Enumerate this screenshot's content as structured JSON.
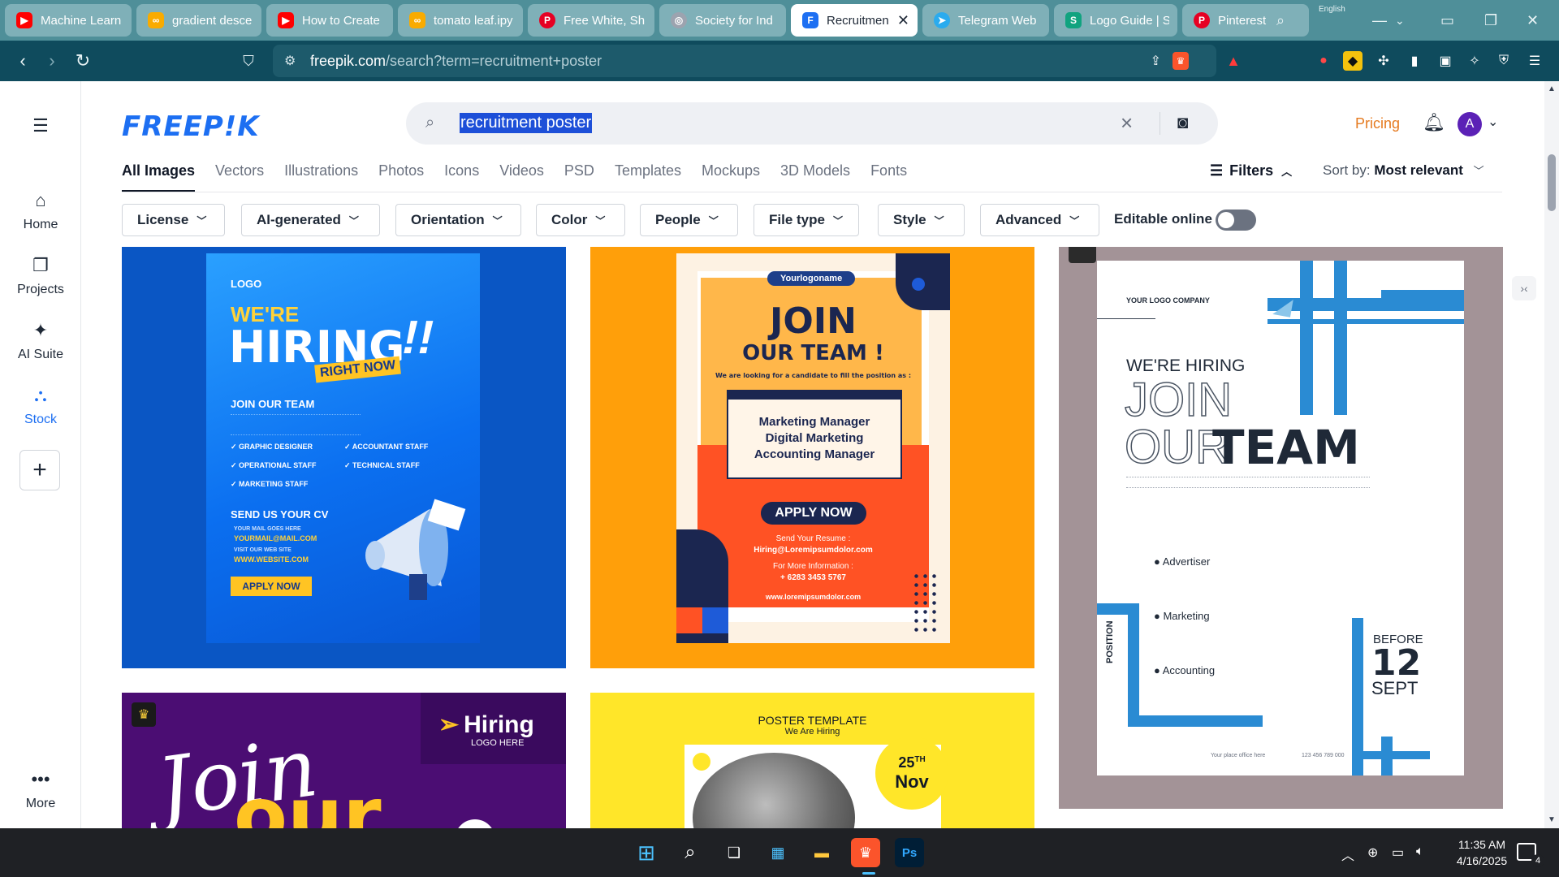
{
  "browser": {
    "tabs": [
      {
        "label": "Machine Learn",
        "icon": "youtube-icon",
        "color": "#ff0000"
      },
      {
        "label": "gradient desce",
        "icon": "colab-icon",
        "color": "#f9ab00"
      },
      {
        "label": "How to Create",
        "icon": "youtube-icon",
        "color": "#ff0000"
      },
      {
        "label": "tomato leaf.ipy",
        "icon": "colab-icon",
        "color": "#f9ab00"
      },
      {
        "label": "Free White, Sh",
        "icon": "pinterest-icon",
        "color": "#e60023"
      },
      {
        "label": "Society for Ind",
        "icon": "globe-icon",
        "color": "#9ca3af"
      },
      {
        "label": "Recruitmen",
        "icon": "freepik-icon",
        "color": "#1d6ff2"
      },
      {
        "label": "Telegram Web",
        "icon": "telegram-icon",
        "color": "#2aabee"
      },
      {
        "label": "Logo Guide | S",
        "icon": "s-icon",
        "color": "#10a37f"
      },
      {
        "label": "Pinterest",
        "icon": "pinterest-icon",
        "color": "#e60023"
      }
    ],
    "url_host": "freepik.com",
    "url_path": "/search?term=recruitment+poster",
    "lang_hint": "English"
  },
  "rail": {
    "items": [
      {
        "label": "Home",
        "icon": "home-icon"
      },
      {
        "label": "Projects",
        "icon": "projects-icon"
      },
      {
        "label": "AI Suite",
        "icon": "sparkle-icon"
      },
      {
        "label": "Stock",
        "icon": "stock-icon"
      }
    ],
    "more_label": "More"
  },
  "header": {
    "logo": "FREEP!K",
    "search_query": "recruitment poster",
    "pricing": "Pricing",
    "avatar_initial": "A"
  },
  "categories": [
    "All Images",
    "Vectors",
    "Illustrations",
    "Photos",
    "Icons",
    "Videos",
    "PSD",
    "Templates",
    "Mockups",
    "3D Models",
    "Fonts"
  ],
  "filters_label": "Filters",
  "sort": {
    "label": "Sort by:",
    "value": "Most relevant"
  },
  "chips": [
    "License",
    "AI-generated",
    "Orientation",
    "Color",
    "People",
    "File type",
    "Style",
    "Advanced"
  ],
  "editable_online": "Editable online",
  "card1": {
    "logo": "LOGO",
    "were": "WE'RE",
    "hiring": "HIRING",
    "right_now": "RIGHT NOW",
    "join": "JOIN OUR TEAM",
    "roles": [
      "GRAPHIC DESIGNER",
      "ACCOUNTANT STAFF",
      "OPERATIONAL STAFF",
      "TECHNICAL STAFF",
      "MARKETING STAFF"
    ],
    "send_cv": "SEND US YOUR CV",
    "mail_label": "YOUR MAIL GOES HERE",
    "mail": "YOURMAIL@MAIL.COM",
    "web_label": "VISIT OUR WEB SITE",
    "web": "WWW.WEBSITE.COM",
    "apply": "APPLY NOW"
  },
  "card2": {
    "logo_name": "Yourlogoname",
    "join": "JOIN",
    "our_team": "OUR TEAM !",
    "looking": "We are looking for a candidate to fill the position as :",
    "positions": [
      "Marketing Manager",
      "Digital Marketing",
      "Accounting Manager"
    ],
    "apply": "APPLY NOW",
    "resume_label": "Send Your Resume :",
    "resume": "Hiring@Loremipsumdolor.com",
    "info_label": "For More Information :",
    "phone": "+ 6283 3453 5767",
    "web": "www.loremipsumdolor.com"
  },
  "card3": {
    "company": "YOUR LOGO COMPANY",
    "were_hiring": "WE'RE HIRING",
    "join": "JOIN",
    "our": "OUR",
    "team": "TEAM",
    "items": [
      "Advertiser",
      "Marketing",
      "Accounting"
    ],
    "position": "POSITION",
    "before": "BEFORE",
    "day": "12",
    "month": "SEPT",
    "office": "Your place office here",
    "phone": "123 456 789 000"
  },
  "card4": {
    "hiring": "Hiring",
    "logo_here": "LOGO HERE",
    "script": "Join",
    "our": "our"
  },
  "card5": {
    "title": "POSTER TEMPLATE",
    "subtitle": "We Are Hiring",
    "day": "25",
    "suffix": "TH",
    "month": "Nov"
  },
  "taskbar": {
    "time": "11:35 AM",
    "date": "4/16/2025",
    "notif": "4"
  }
}
